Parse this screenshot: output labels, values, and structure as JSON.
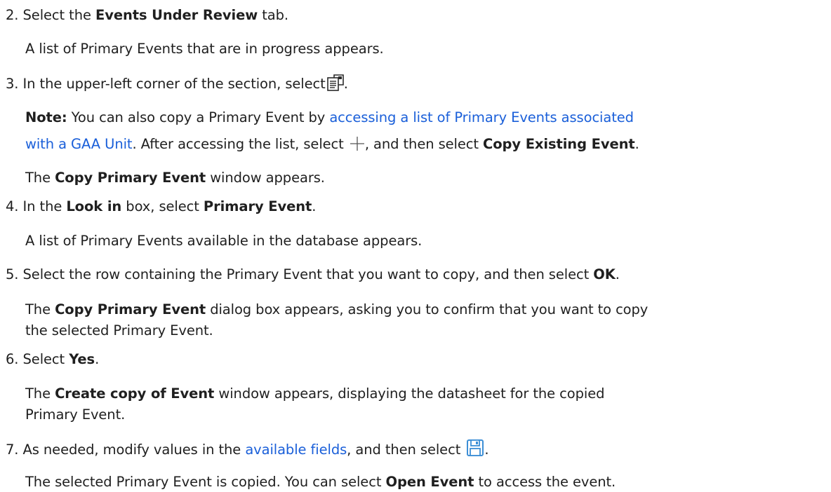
{
  "steps": {
    "s2": {
      "number": "2.",
      "pre": "Select the",
      "bold": "Events Under Review",
      "post": "tab.",
      "result": "A list of Primary Events that are in progress appears."
    },
    "s3": {
      "number": "3.",
      "text": "In the upper-left corner of the section, select",
      "end": ".",
      "icon": "copy-document-icon",
      "note": {
        "label": "Note:",
        "pre": "You can also copy a Primary Event by",
        "link1": "accessing a list of Primary Events associated",
        "link2": "with a GAA Unit",
        "mid": ". After accessing the list, select",
        "plus_icon": "plus-icon",
        "mid2": ", and then select",
        "bold": "Copy Existing Event",
        "end": "."
      },
      "result_pre": "The",
      "result_bold": "Copy Primary Event",
      "result_post": "window appears."
    },
    "s4": {
      "number": "4.",
      "pre": "In the",
      "bold1": "Look in",
      "mid": "box, select",
      "bold2": "Primary Event",
      "end": ".",
      "result": "A list of Primary Events available in the database appears."
    },
    "s5": {
      "number": "5.",
      "text": "Select the row containing the Primary Event that you want to copy, and then select",
      "bold": "OK",
      "end": ".",
      "result_pre": "The",
      "result_bold": "Copy Primary Event",
      "result_post": "dialog box appears, asking you to confirm that you want to copy",
      "result_line2": "the selected Primary Event."
    },
    "s6": {
      "number": "6.",
      "pre": "Select",
      "bold": "Yes",
      "end": ".",
      "result_pre": "The",
      "result_bold": "Create copy of Event",
      "result_post": "window appears, displaying the datasheet for the copied",
      "result_line2": "Primary Event."
    },
    "s7": {
      "number": "7.",
      "pre": "As needed, modify values in the",
      "link": "available fields",
      "mid": ", and then select",
      "icon": "save-icon",
      "end": ".",
      "result_pre": "The selected Primary Event is copied. You can select",
      "result_bold": "Open Event",
      "result_post": "to access the event."
    }
  },
  "colors": {
    "text": "#1f1f1f",
    "link": "#1a5fd9",
    "save_icon": "#3d8fd6"
  }
}
